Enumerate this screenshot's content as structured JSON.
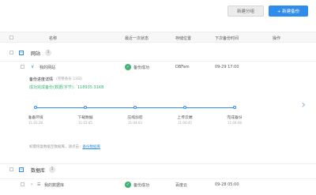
{
  "toolbar": {
    "new_group": "新建分组",
    "new_backup": "+ 新建备份"
  },
  "table": {
    "headers": {
      "name": "名称",
      "last_status": "最近一次状态",
      "storage": "存储位置",
      "next_time": "下次备份时间",
      "actions": "操作"
    }
  },
  "group1": {
    "title": "网站",
    "count": "1"
  },
  "row1": {
    "name": "我的网站",
    "status": "备份成功",
    "storage": "DBFam",
    "next_time": "09-29 17:00"
  },
  "detail": {
    "title": "备份进度详情",
    "subtitle": "(完整备份 23日)",
    "success": "成功完成备份(数据(字节)：118935.31KB",
    "steps": [
      {
        "label": "准备环境",
        "time": "11:03:28"
      },
      {
        "label": "下载数据",
        "time": "11:03:45"
      },
      {
        "label": "压缩加密",
        "time": "11:04:03"
      },
      {
        "label": "上传云端",
        "time": "11:04:45"
      },
      {
        "label": "完成备份",
        "time": "11:04:48"
      }
    ],
    "note_prefix": "如需恢复数据至数据库，请点击：",
    "note_link": "备份数据库"
  },
  "group2": {
    "title": "数据库",
    "count": "1"
  },
  "row2": {
    "name": "我的数据库",
    "status": "备份成功",
    "storage": "百度云",
    "next_time": "09-28 05:00"
  },
  "colors": {
    "accent": "#2f8ceb",
    "success": "#3cb371"
  }
}
